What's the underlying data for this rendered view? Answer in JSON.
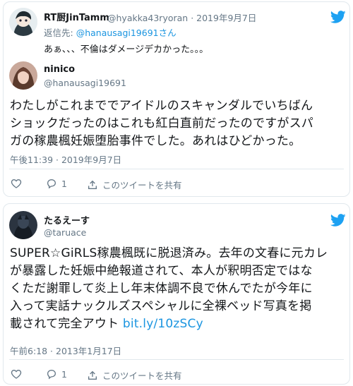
{
  "tweet1": {
    "reply": {
      "display_name": "RT厨JinTamm",
      "handle": "@hyakka43ryoran",
      "date": "· 2019年9月7日",
      "reply_to_label": "返信先: ",
      "reply_to_user": "@hanausagi19691さん",
      "text": "あぁ、、、不倫はダメージデカかった。。。"
    },
    "author": {
      "display_name": "ninico",
      "handle": "@hanausagi19691"
    },
    "text_lines": [
      "わたしがこれまででアイドルのスキャンダルでいちばん",
      "ショックだったのはこれも紅白直前だったのですがスパ",
      "ガの稼農楓妊娠堕胎事件でした。あれはひどかった。"
    ],
    "timestamp": "午後11:39 · 2019年9月7日",
    "actions": {
      "reply_count": "1",
      "share_label": "このツイートを共有"
    }
  },
  "tweet2": {
    "author": {
      "display_name": "たるえーす",
      "handle": "@taruace"
    },
    "text_lines": [
      "SUPER☆GiRLS稼農楓既に脱退済み。去年の文春に元カレ",
      "が暴露した妊娠中絶報道されて、本人が釈明否定ではな",
      "くただ謝罪して炎上し年末体調不良で休んでたが今年に",
      "入って実話ナックルズスペシャルに全裸ベッド写真を掲"
    ],
    "last_line_text": "載されて完全アウト ",
    "link": "bit.ly/10zSCy",
    "timestamp": "午前6:18 · 2013年1月17日",
    "actions": {
      "reply_count": "1",
      "share_label": "このツイートを共有"
    }
  },
  "colors": {
    "twitter_blue": "#1da1f2",
    "link": "#1b95e0",
    "muted": "#657786",
    "border": "#e1e8ed"
  }
}
